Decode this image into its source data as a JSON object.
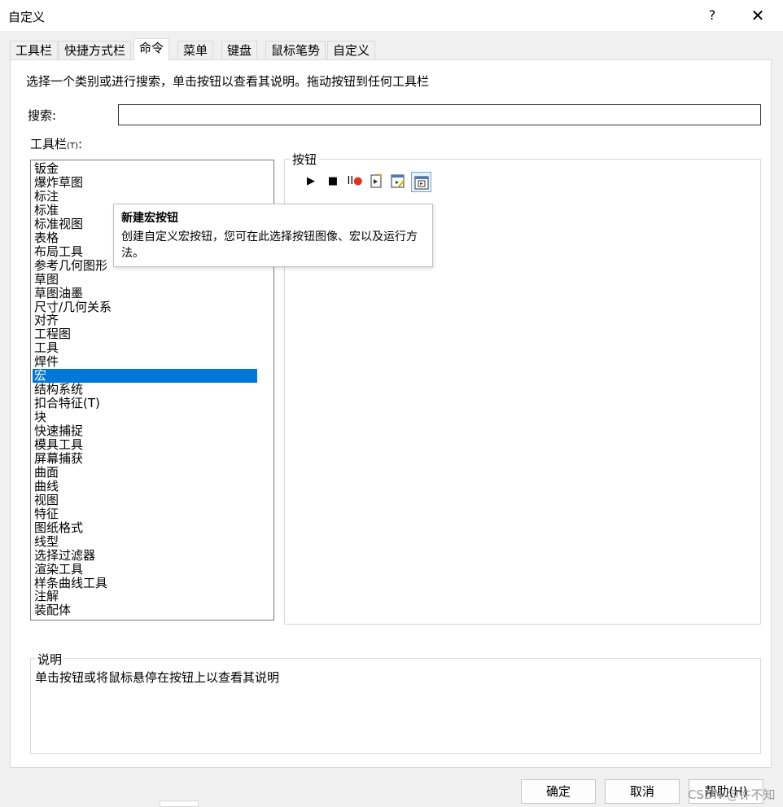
{
  "window": {
    "title": "自定义",
    "help": "?",
    "close": "✕"
  },
  "tabs": [
    {
      "label": "工具栏"
    },
    {
      "label": "快捷方式栏"
    },
    {
      "label": "命令",
      "active": true
    },
    {
      "label": "菜单"
    },
    {
      "label": "键盘"
    },
    {
      "label": "鼠标笔势"
    },
    {
      "label": "自定义"
    }
  ],
  "hint": "选择一个类别或进行搜索，单击按钮以查看其说明。拖动按钮到任何工具栏",
  "search": {
    "label": "搜索:",
    "value": ""
  },
  "toolbar_list": {
    "label": "工具栏",
    "shortcut": "(T)",
    "colon": ":",
    "selected": "宏",
    "items": [
      "钣金",
      "爆炸草图",
      "标注",
      "标准",
      "标准视图",
      "表格",
      "布局工具",
      "参考几何图形",
      "草图",
      "草图油墨",
      "尺寸/几何关系",
      "对齐",
      "工程图",
      "工具",
      "焊件",
      "宏",
      "结构系统",
      "扣合特征(T)",
      "块",
      "快速捕捉",
      "模具工具",
      "屏幕捕获",
      "曲面",
      "曲线",
      "视图",
      "特征",
      "图纸格式",
      "线型",
      "选择过滤器",
      "渲染工具",
      "样条曲线工具",
      "注解",
      "装配体"
    ]
  },
  "buttons_panel": {
    "label": "按钮",
    "icons": [
      {
        "name": "run-macro-icon",
        "glyph": "▶"
      },
      {
        "name": "stop-macro-icon",
        "glyph": "■"
      },
      {
        "name": "pause-record-icon",
        "glyph": "II●"
      },
      {
        "name": "new-macro-icon",
        "glyph": "📄"
      },
      {
        "name": "edit-macro-icon",
        "glyph": "✎"
      },
      {
        "name": "new-macro-button-icon",
        "glyph": "⊡"
      }
    ]
  },
  "tooltip": {
    "title": "新建宏按钮",
    "text": "创建自定义宏按钮，您可在此选择按钮图像、宏以及运行方法。"
  },
  "description": {
    "label": "说明",
    "text": "单击按钮或将鼠标悬停在按钮上以查看其说明"
  },
  "footer": {
    "ok": "确定",
    "cancel": "取消",
    "help": "帮助(H)"
  },
  "watermark": "CSDN @许不知",
  "colors": {
    "selection": "#0078d7",
    "record_dot": "#e0301e"
  }
}
